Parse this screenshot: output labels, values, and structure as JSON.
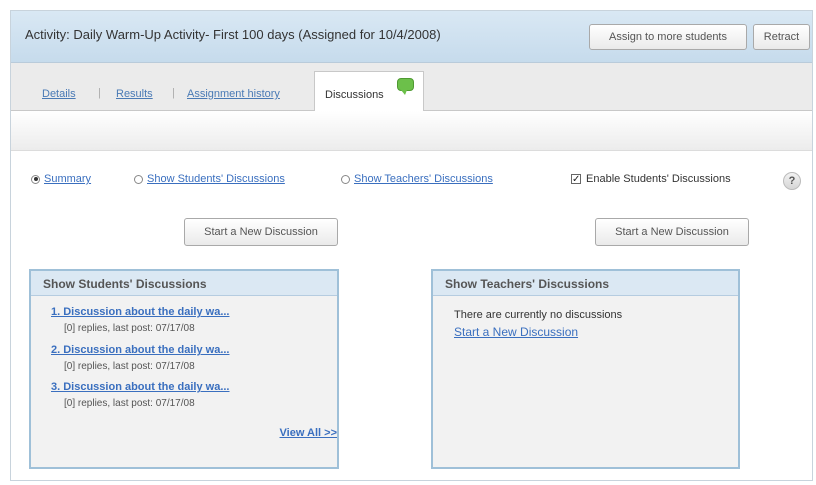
{
  "header": {
    "title": "Activity: Daily Warm-Up Activity- First 100 days (Assigned for 10/4/2008)",
    "assign_label": "Assign to more students",
    "retract_label": "Retract"
  },
  "tabs": [
    {
      "label": "Details"
    },
    {
      "label": "Results"
    },
    {
      "label": "Assignment history"
    },
    {
      "label": "Discussions"
    }
  ],
  "options": {
    "summary": "Summary",
    "students": "Show Students' Discussions",
    "teachers": "Show Teachers' Discussions",
    "enable": "Enable Students' Discussions",
    "help": "?"
  },
  "start_button_label": "Start a New Discussion",
  "students_panel": {
    "title": "Show Students' Discussions",
    "items": [
      {
        "title": "1. Discussion about the daily wa...",
        "meta": "[0] replies, last post: 07/17/08"
      },
      {
        "title": "2. Discussion about the daily wa...",
        "meta": "[0] replies, last post: 07/17/08"
      },
      {
        "title": "3. Discussion about the daily wa...",
        "meta": "[0] replies, last post: 07/17/08"
      }
    ],
    "view_all": "View All >>"
  },
  "teachers_panel": {
    "title": "Show Teachers' Discussions",
    "empty_text": "There are currently no discussions",
    "start_link": "Start a New Discussion"
  }
}
